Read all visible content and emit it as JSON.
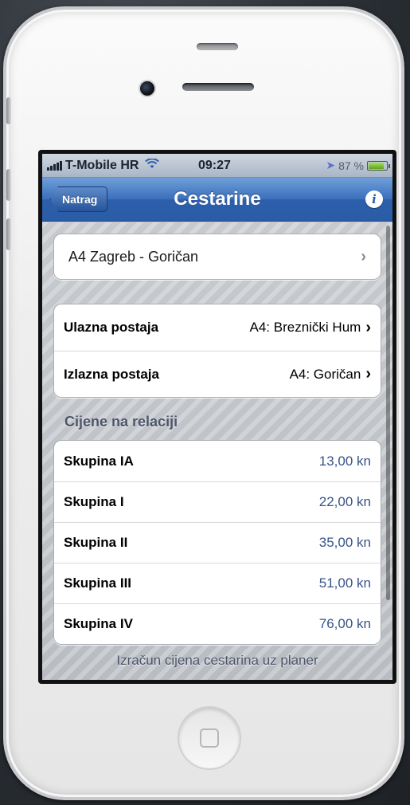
{
  "status_bar": {
    "carrier": "T-Mobile HR",
    "time": "09:27",
    "battery": "87 %",
    "battery_level": 0.87
  },
  "nav": {
    "back_label": "Natrag",
    "title": "Cestarine",
    "info_icon": "info-icon"
  },
  "route": {
    "label": "A4 Zagreb - Goričan"
  },
  "stations": [
    {
      "label": "Ulazna postaja",
      "value": "A4: Breznički Hum"
    },
    {
      "label": "Izlazna postaja",
      "value": "A4: Goričan"
    }
  ],
  "prices_header": "Cijene na relaciji",
  "prices": [
    {
      "label": "Skupina IA",
      "value": "13,00 kn"
    },
    {
      "label": "Skupina I",
      "value": "22,00 kn"
    },
    {
      "label": "Skupina II",
      "value": "35,00 kn"
    },
    {
      "label": "Skupina III",
      "value": "51,00 kn"
    },
    {
      "label": "Skupina IV",
      "value": "76,00 kn"
    }
  ],
  "footer": "Izračun cijena cestarina uz planer"
}
